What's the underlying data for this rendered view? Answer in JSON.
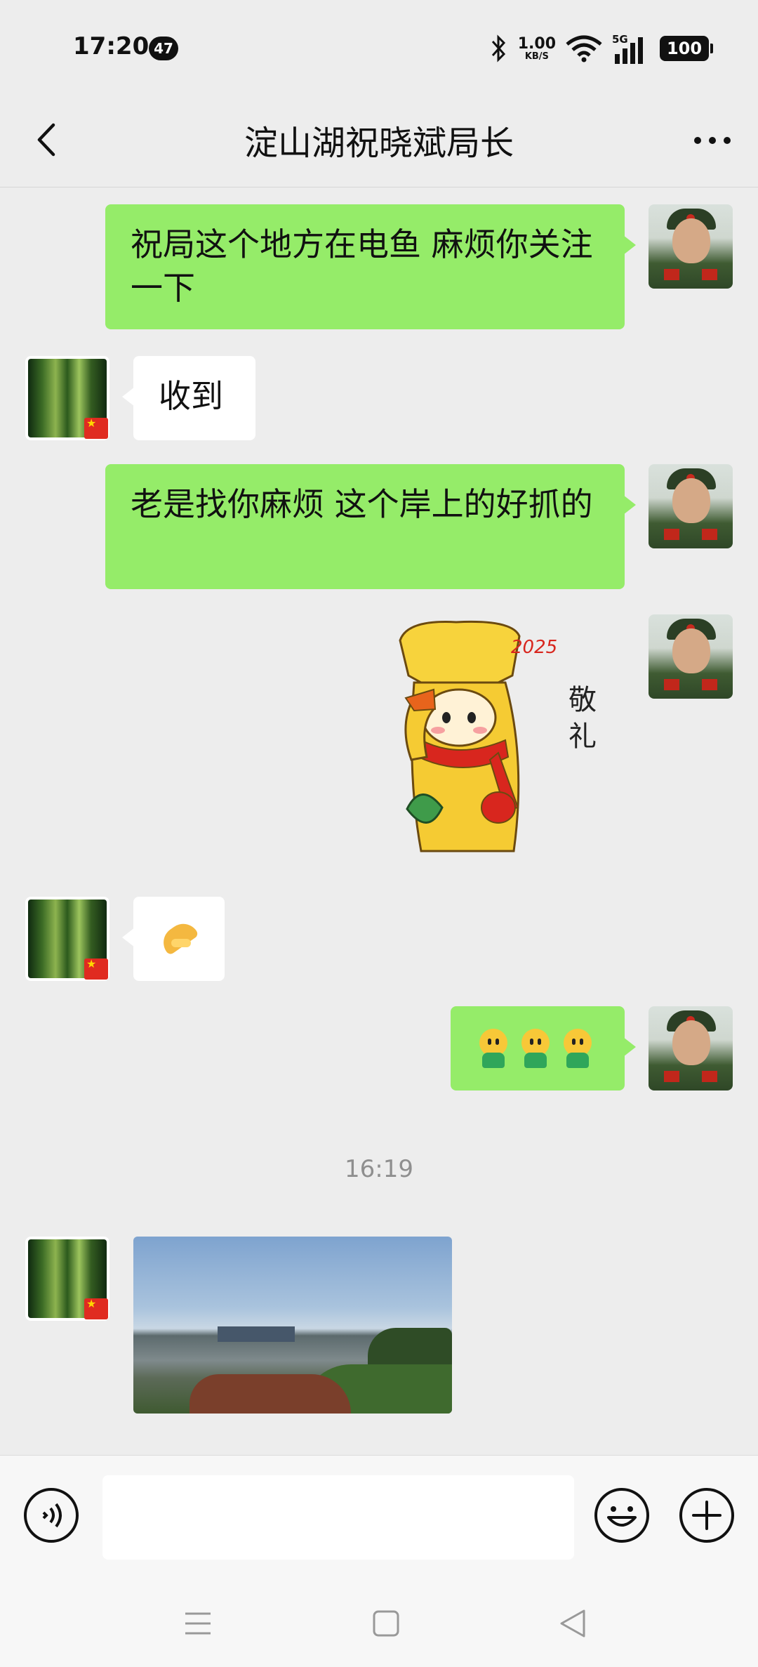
{
  "status_bar": {
    "time": "17:20",
    "notification_count": "47",
    "net_speed_value": "1.00",
    "net_speed_unit": "KB/S",
    "network_type": "5G",
    "battery": "100"
  },
  "header": {
    "title": "淀山湖祝晓斌局长"
  },
  "messages": [
    {
      "sender": "self",
      "type": "text",
      "text": "祝局这个地方在电鱼 麻烦你关注一下"
    },
    {
      "sender": "other",
      "type": "text",
      "text": "收到"
    },
    {
      "sender": "self",
      "type": "text",
      "text": "老是找你麻烦 这个岸上的好抓的"
    },
    {
      "sender": "self",
      "type": "sticker",
      "sticker_text": "敬礼",
      "sticker_year": "2025"
    },
    {
      "sender": "other",
      "type": "emoji",
      "icon": "folded-hands-emoji"
    },
    {
      "sender": "self",
      "type": "emoji",
      "icon": "smiley-emoji",
      "count": 3
    },
    {
      "sender": "other",
      "type": "image",
      "description_icon": "lake-photo"
    }
  ],
  "timestamp": "16:19",
  "colors": {
    "self_bubble": "#95ec69",
    "other_bubble": "#ffffff",
    "background": "#ededed"
  }
}
